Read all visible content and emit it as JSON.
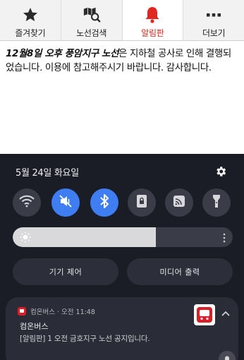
{
  "tabs": [
    {
      "label": "즐겨찾기",
      "icon": "star-icon",
      "active": false
    },
    {
      "label": "노선검색",
      "icon": "map-search-icon",
      "active": false
    },
    {
      "label": "알림판",
      "icon": "bell-icon",
      "active": true
    },
    {
      "label": "더보기",
      "icon": "more-icon",
      "active": false
    }
  ],
  "notice": {
    "emphasis": "12월8일 오후 풍암지구 노선",
    "text": "은 지하철 공사로 인해 결행되었습니다. 이용에 참고해주시기 바랍니다. 감사합니다."
  },
  "shade": {
    "date": "5월 24일 화요일",
    "quick_settings": [
      {
        "icon": "wifi-icon",
        "on": false
      },
      {
        "icon": "mute-icon",
        "on": true
      },
      {
        "icon": "bluetooth-icon",
        "on": true
      },
      {
        "icon": "lock-rotation-icon",
        "on": false
      },
      {
        "icon": "cast-icon",
        "on": false
      },
      {
        "icon": "flashlight-icon",
        "on": false
      }
    ],
    "brightness_level": 0.65,
    "device_control": "기기 제어",
    "media_output": "미디어 출력"
  },
  "notification": {
    "meta": "컴온버스 · 오전 11:48",
    "title": "컴온버스",
    "body": "[알림판] 1 오전 금호지구 노선 공지입니다."
  },
  "colors": {
    "accent_red": "#e0261e",
    "toggle_on": "#3e7ef2"
  }
}
